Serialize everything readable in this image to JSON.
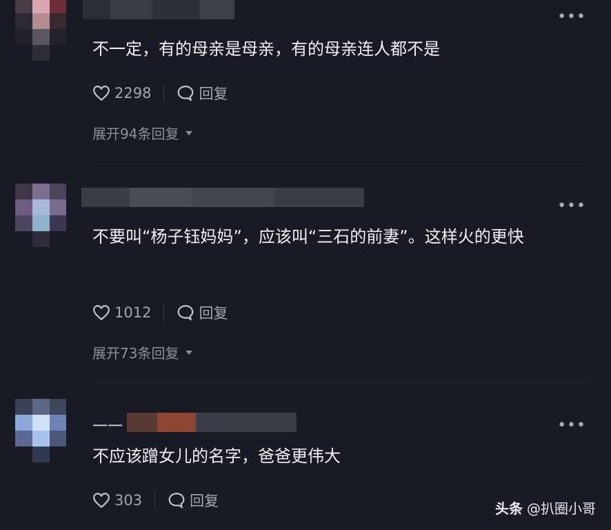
{
  "comments": [
    {
      "text": "不一定，有的母亲是母亲，有的母亲连人都不是",
      "likes": "2298",
      "reply_label": "回复",
      "expand_label": "展开94条回复",
      "more_icon": "ellipsis-icon"
    },
    {
      "text": "不要叫“杨子钰妈妈”，应该叫“三石的前妻”。这样火的更快",
      "likes": "1012",
      "reply_label": "回复",
      "expand_label": "展开73条回复",
      "more_icon": "ellipsis-icon"
    },
    {
      "name_prefix": "一一",
      "text": "不应该蹭女儿的名字，爸爸更伟大",
      "likes": "303",
      "reply_label": "回复",
      "more_icon": "ellipsis-icon"
    }
  ],
  "watermark": {
    "brand": "头条",
    "handle": "@扒圈小哥"
  },
  "colors": {
    "background": "#191a24",
    "text": "#f0f0f4",
    "muted": "#a4a5b0"
  }
}
